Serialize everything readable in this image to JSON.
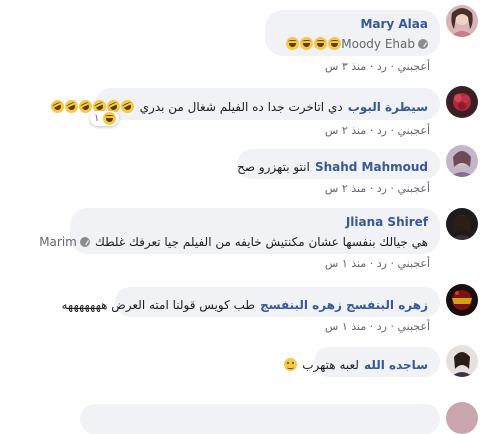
{
  "action_like": "أعجبني",
  "action_reply": "رد",
  "sep": "·",
  "comments": [
    {
      "author": "Mary Alaa",
      "mention": "Moody Ehab",
      "emojis": [
        "laugh",
        "laugh",
        "laugh",
        "laugh"
      ],
      "time": "منذ ٣ س"
    },
    {
      "author": "سيطرة البوب",
      "text": "دي اتاخرت جدا ده الفيلم شغال من بدري",
      "emojis": [
        "rofl",
        "rofl",
        "rofl",
        "rofl",
        "rofl",
        "rofl"
      ],
      "reaction_count": "١",
      "time": "منذ ٢ س"
    },
    {
      "author": "Shahd Mahmoud",
      "text": "انتو بتهزرو صح",
      "time": "منذ ٢ س"
    },
    {
      "author": "Jliana Shiref",
      "text": "هي جيالك بنفسها عشان مكنتيش خايفه من الفيلم جيا تعرفك غلطك",
      "mention": "Marim",
      "time": "منذ ١ س"
    },
    {
      "author": "زهره البنفسج زهره البنفسج",
      "text": "طب كويس قولنا امته العرض هههههههه",
      "time": "منذ ١ س"
    },
    {
      "author": "ساجده الله",
      "text": "لعبه هتهرب",
      "emojis": [
        "wink"
      ],
      "time": ""
    }
  ]
}
